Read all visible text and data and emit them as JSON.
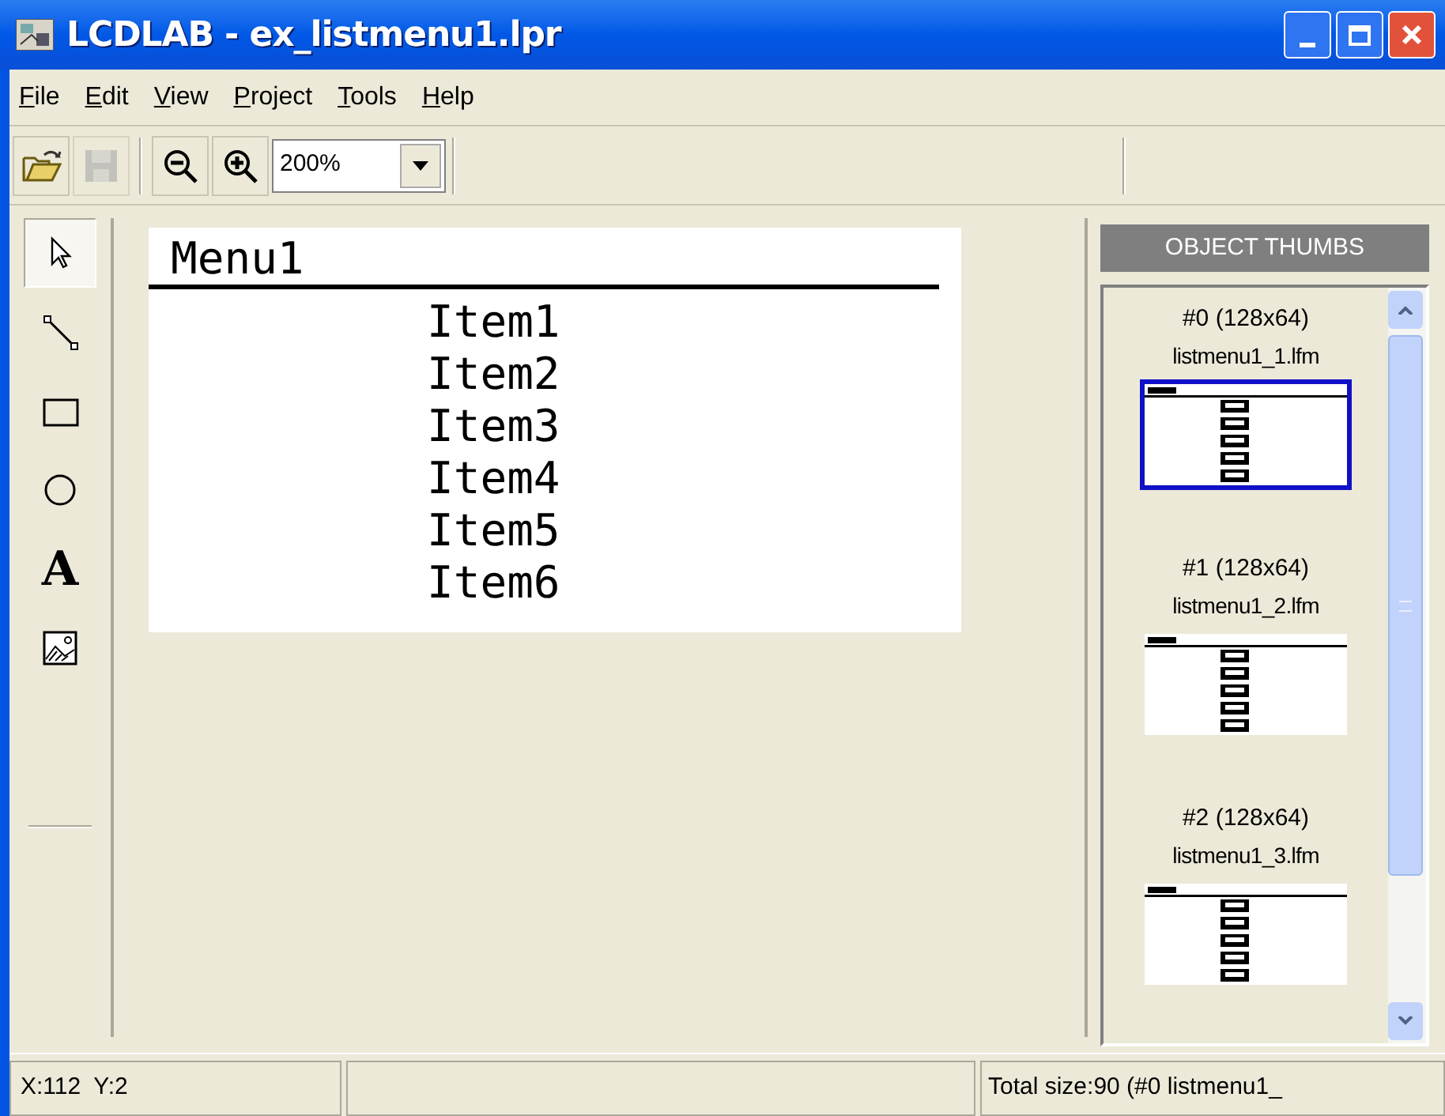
{
  "window": {
    "title": "LCDLAB - ex_listmenu1.lpr"
  },
  "menu": [
    {
      "label": "File"
    },
    {
      "label": "Edit"
    },
    {
      "label": "View"
    },
    {
      "label": "Project"
    },
    {
      "label": "Tools"
    },
    {
      "label": "Help"
    }
  ],
  "toolbar": {
    "buttons": [
      {
        "kind": "open",
        "disabled": false
      },
      {
        "kind": "save",
        "disabled": true
      },
      {
        "kind": "zoom-out",
        "disabled": false
      },
      {
        "kind": "zoom-in",
        "disabled": false
      }
    ],
    "zoom": "200%"
  },
  "tools": [
    {
      "kind": "pointer",
      "selected": true
    },
    {
      "kind": "line",
      "selected": false
    },
    {
      "kind": "rect",
      "selected": false
    },
    {
      "kind": "ellipse",
      "selected": false
    },
    {
      "kind": "text",
      "selected": false,
      "glyph": "A"
    },
    {
      "kind": "image",
      "selected": false
    }
  ],
  "canvas": {
    "heading": "Menu1",
    "items": [
      "Item1",
      "Item2",
      "Item3",
      "Item4",
      "Item5",
      "Item6"
    ]
  },
  "thumbs_panel": {
    "title": "OBJECT THUMBS",
    "thumbs": [
      {
        "label": "#0 (128x64)",
        "file": "listmenu1_1.lfm",
        "selected": true
      },
      {
        "label": "#1 (128x64)",
        "file": "listmenu1_2.lfm",
        "selected": false
      },
      {
        "label": "#2 (128x64)",
        "file": "listmenu1_3.lfm",
        "selected": false
      }
    ]
  },
  "status_bar": {
    "position": "X:112  Y:2",
    "info": "Total size:90 (#0 listmenu1_"
  }
}
